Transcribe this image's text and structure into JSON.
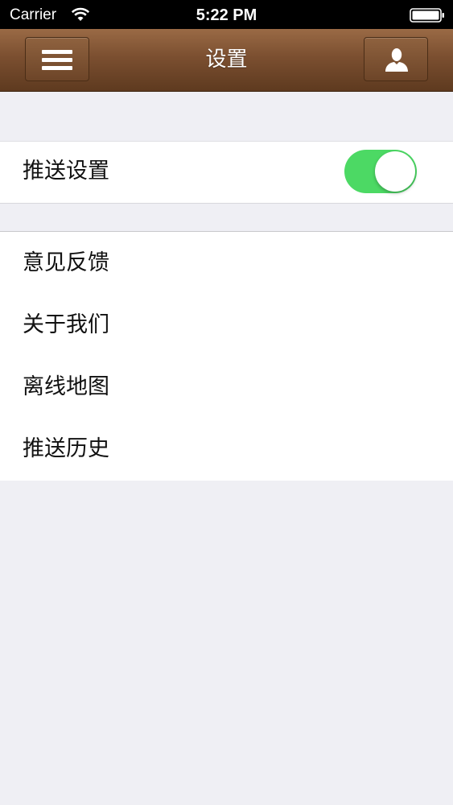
{
  "status_bar": {
    "carrier": "Carrier",
    "time": "5:22 PM"
  },
  "nav": {
    "title": "设置",
    "left_icon": "menu-icon",
    "right_icon": "profile-icon",
    "bar_color": "#7b4f30"
  },
  "settings": {
    "push_row": {
      "label": "推送设置",
      "toggle_on": true,
      "toggle_color": "#4cd964"
    },
    "items": [
      {
        "label": "意见反馈"
      },
      {
        "label": "关于我们"
      },
      {
        "label": "离线地图"
      },
      {
        "label": "推送历史"
      }
    ]
  }
}
